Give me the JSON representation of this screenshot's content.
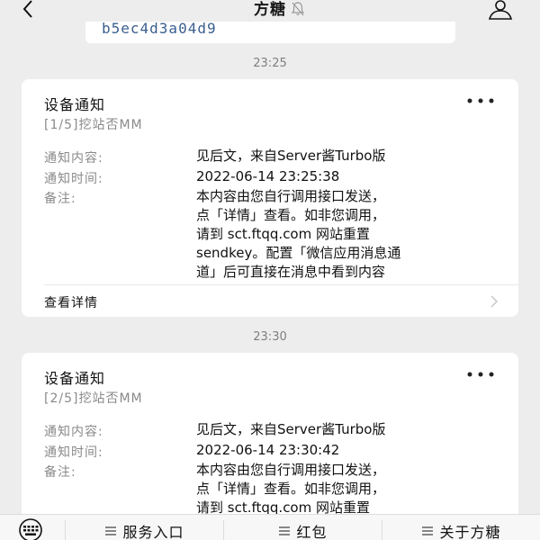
{
  "header": {
    "title": "方糖"
  },
  "prev_card": {
    "text": "b5ec4d3a04d9"
  },
  "messages": [
    {
      "time": "23:25",
      "title": "设备通知",
      "subtitle": "[1/5]挖站否MM",
      "content_label": "通知内容:",
      "content_value": "见后文，来自Server酱Turbo版",
      "time_label": "通知时间:",
      "time_value": "2022-06-14 23:25:38",
      "note_label": "备注:",
      "note_lines": [
        "本内容由您自行调用接口发送，",
        "点「详情」查看。如非您调用，",
        "请到 sct.ftqq.com 网站重置",
        "sendkey。配置「微信应用消息通",
        "道」后可直接在消息中看到内容"
      ],
      "detail_label": "查看详情"
    },
    {
      "time": "23:30",
      "title": "设备通知",
      "subtitle": "[2/5]挖站否MM",
      "content_label": "通知内容:",
      "content_value": "见后文，来自Server酱Turbo版",
      "time_label": "通知时间:",
      "time_value": "2022-06-14 23:30:42",
      "note_label": "备注:",
      "note_lines": [
        "本内容由您自行调用接口发送，",
        "点「详情」查看。如非您调用，",
        "请到 sct.ftqq.com 网站重置"
      ]
    }
  ],
  "bottom_menu": {
    "items": [
      "服务入口",
      "红包",
      "关于方糖"
    ]
  },
  "icons": {
    "back": "back-icon",
    "mute": "mute-bell-icon",
    "profile": "person-icon",
    "more": "more-dots-icon",
    "chevron": "chevron-right-icon",
    "keyboard": "keyboard-icon",
    "menu": "list-icon"
  }
}
